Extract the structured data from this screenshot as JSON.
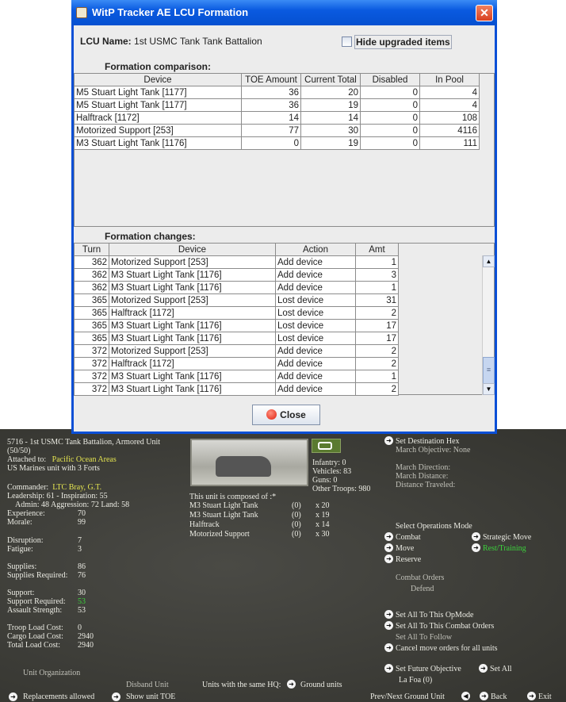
{
  "dialog": {
    "title": "WitP Tracker AE LCU Formation",
    "lcu_label": "LCU Name:",
    "lcu_name": "1st USMC Tank Tank Battalion",
    "hide_upgraded": "Hide upgraded items",
    "hide_upgraded_checked": false,
    "comparison_title": "Formation comparison:",
    "changes_title": "Formation changes:",
    "close_label": "Close",
    "comparison": {
      "headers": [
        "Device",
        "TOE Amount",
        "Current Total",
        "Disabled",
        "In Pool"
      ],
      "rows": [
        [
          "M5 Stuart Light Tank [1177]",
          "36",
          "20",
          "0",
          "4"
        ],
        [
          "M5 Stuart Light Tank [1177]",
          "36",
          "19",
          "0",
          "4"
        ],
        [
          "Halftrack [1172]",
          "14",
          "14",
          "0",
          "108"
        ],
        [
          "Motorized Support [253]",
          "77",
          "30",
          "0",
          "4116"
        ],
        [
          "M3 Stuart Light Tank [1176]",
          "0",
          "19",
          "0",
          "111"
        ]
      ]
    },
    "changes": {
      "headers": [
        "Turn",
        "Device",
        "Action",
        "Amt"
      ],
      "rows": [
        [
          "362",
          "Motorized Support [253]",
          "Add device",
          "1"
        ],
        [
          "362",
          "M3 Stuart Light Tank [1176]",
          "Add device",
          "3"
        ],
        [
          "362",
          "M3 Stuart Light Tank [1176]",
          "Add device",
          "1"
        ],
        [
          "365",
          "Motorized Support [253]",
          "Lost device",
          "31"
        ],
        [
          "365",
          "Halftrack [1172]",
          "Lost device",
          "2"
        ],
        [
          "365",
          "M3 Stuart Light Tank [1176]",
          "Lost device",
          "17"
        ],
        [
          "365",
          "M3 Stuart Light Tank [1176]",
          "Lost device",
          "17"
        ],
        [
          "372",
          "Motorized Support [253]",
          "Add device",
          "2"
        ],
        [
          "372",
          "Halftrack [1172]",
          "Add device",
          "2"
        ],
        [
          "372",
          "M3 Stuart Light Tank [1176]",
          "Add device",
          "1"
        ],
        [
          "372",
          "M3 Stuart Light Tank [1176]",
          "Add device",
          "2"
        ]
      ]
    }
  },
  "unit": {
    "title": "5716 - 1st USMC Tank Battalion, Armored Unit",
    "strength": "(50/50)",
    "attached_label": "Attached to:",
    "attached": "Pacific Ocean Areas",
    "forts": "US Marines unit with 3 Forts",
    "commander_label": "Commander:",
    "commander": "LTC Bray, G.T.",
    "leadership": "Leadership: 61 - Inspiration: 55",
    "admin": "Admin: 48  Aggression: 72  Land: 58",
    "stats": [
      {
        "label": "Experience:",
        "value": "70"
      },
      {
        "label": "Morale:",
        "value": "99"
      },
      {
        "label": "Disruption:",
        "value": "7"
      },
      {
        "label": "Fatigue:",
        "value": "3"
      },
      {
        "label": "Supplies:",
        "value": "86"
      },
      {
        "label": "Supplies Required:",
        "value": "76"
      },
      {
        "label": "Support:",
        "value": "30"
      },
      {
        "label": "Support Required:",
        "value": "53"
      },
      {
        "label": "Assault Strength:",
        "value": "53"
      },
      {
        "label": "Troop Load Cost:",
        "value": "0"
      },
      {
        "label": "Cargo Load Cost:",
        "value": "2940"
      },
      {
        "label": "Total Load Cost:",
        "value": "2940"
      }
    ],
    "unit_org": "Unit Organization",
    "disband": "Disband Unit",
    "replacements": "Replacements allowed",
    "show_toe": "Show unit TOE",
    "infantry": "Infantry: 0",
    "vehicles": "Vehicles: 83",
    "guns": "Guns: 0",
    "other": "Other Troops: 980",
    "composed": "This unit is composed of :*",
    "composition": [
      [
        "M3 Stuart Light Tank",
        "(0)",
        "x 20"
      ],
      [
        "M3 Stuart Light Tank",
        "(0)",
        "x 19"
      ],
      [
        "Halftrack",
        "(0)",
        "x 14"
      ],
      [
        "Motorized Support",
        "(0)",
        "x 30"
      ]
    ],
    "same_hq": "Units with the same HQ:",
    "ground_units": "Ground units"
  },
  "orders": {
    "set_dest": "Set Destination Hex",
    "march_obj": "March Objective: None",
    "march_dir": "March Direction:",
    "march_dist": "March Distance:",
    "dist_trav": "Distance Traveled:",
    "select_ops": "Select Operations Mode",
    "combat": "Combat",
    "strategic": "Strategic Move",
    "move": "Move",
    "rest": "Rest/Training",
    "reserve": "Reserve",
    "combat_orders": "Combat Orders",
    "defend": "Defend",
    "set_all_op": "Set All To This OpMode",
    "set_all_combat": "Set All To This Combat Orders",
    "set_all_follow": "Set All To Follow",
    "cancel_move": "Cancel move orders for all units",
    "future_obj": "Set Future Objective",
    "set_all": "Set All",
    "la_foa": "La Foa (0)",
    "prev_next": "Prev/Next Ground Unit",
    "back": "Back",
    "exit": "Exit"
  }
}
